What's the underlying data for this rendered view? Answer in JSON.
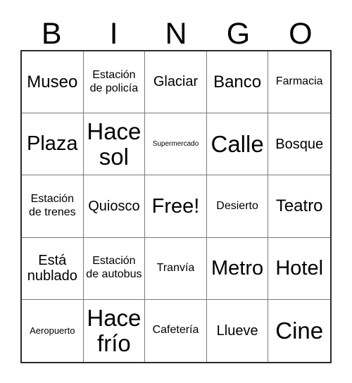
{
  "card": {
    "type": "bingo-card",
    "header": {
      "letters": [
        "B",
        "I",
        "N",
        "G",
        "O"
      ]
    },
    "grid": {
      "rows": 5,
      "columns": 5,
      "border_color": "#2b2b2b",
      "inner_line_color": "#7a7a7a",
      "background_color": "#ffffff",
      "text_color": "#000000",
      "cells": [
        {
          "text": "Museo",
          "size": "lg",
          "free": false
        },
        {
          "text": "Estación de policía",
          "size": "sm",
          "free": false
        },
        {
          "text": "Glaciar",
          "size": "md",
          "free": false
        },
        {
          "text": "Banco",
          "size": "lg",
          "free": false
        },
        {
          "text": "Farmacia",
          "size": "sm",
          "free": false
        },
        {
          "text": "Plaza",
          "size": "xl",
          "free": false
        },
        {
          "text": "Hace sol",
          "size": "xxl",
          "free": false
        },
        {
          "text": "Supermercado",
          "size": "xxs",
          "free": false
        },
        {
          "text": "Calle",
          "size": "xxl",
          "free": false
        },
        {
          "text": "Bosque",
          "size": "md",
          "free": false
        },
        {
          "text": "Estación de trenes",
          "size": "sm",
          "free": false
        },
        {
          "text": "Quiosco",
          "size": "md",
          "free": false
        },
        {
          "text": "Free!",
          "size": "xl",
          "free": true
        },
        {
          "text": "Desierto",
          "size": "sm",
          "free": false
        },
        {
          "text": "Teatro",
          "size": "lg",
          "free": false
        },
        {
          "text": "Está nublado",
          "size": "md",
          "free": false
        },
        {
          "text": "Estación de autobus",
          "size": "sm",
          "free": false
        },
        {
          "text": "Tranvía",
          "size": "sm",
          "free": false
        },
        {
          "text": "Metro",
          "size": "xl",
          "free": false
        },
        {
          "text": "Hotel",
          "size": "xl",
          "free": false
        },
        {
          "text": "Aeropuerto",
          "size": "xs",
          "free": false
        },
        {
          "text": "Hace frío",
          "size": "xxl",
          "free": false
        },
        {
          "text": "Cafetería",
          "size": "sm",
          "free": false
        },
        {
          "text": "Llueve",
          "size": "md",
          "free": false
        },
        {
          "text": "Cine",
          "size": "xxl",
          "free": false
        }
      ]
    }
  }
}
